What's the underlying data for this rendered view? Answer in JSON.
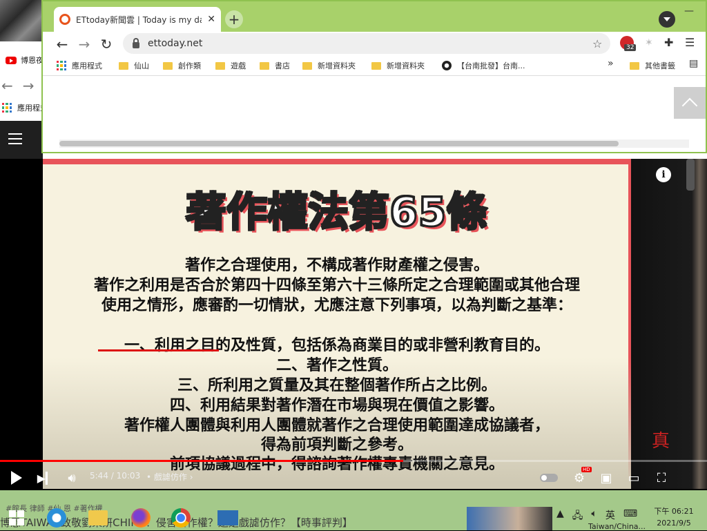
{
  "background_window": {
    "yt_label": "博恩夜",
    "apps_label": "應用程式"
  },
  "chrome": {
    "tab_title": "ETtoday新聞雲 | Today is my day",
    "url": "ettoday.net",
    "extension_count": "32",
    "bookmarks": [
      {
        "label": "應用程式",
        "icon": "apps-grid-icon"
      },
      {
        "label": "仙山",
        "icon": "folder-icon"
      },
      {
        "label": "創作類",
        "icon": "folder-icon"
      },
      {
        "label": "遊戲",
        "icon": "folder-icon"
      },
      {
        "label": "書店",
        "icon": "folder-icon"
      },
      {
        "label": "新增資料夾",
        "icon": "folder-icon"
      },
      {
        "label": "新增資料夾",
        "icon": "folder-icon"
      },
      {
        "label": "【台南批發】台南...",
        "icon": "site-icon"
      }
    ],
    "bookmarks_more": "»",
    "other_bookmarks": "其他書籤"
  },
  "video": {
    "slide_title": "著作權法第65條",
    "slide_lines": [
      "著作之合理使用，不構成著作財產權之侵害。",
      "著作之利用是否合於第四十四條至第六十三條所定之合理範圍或其他合理",
      "使用之情形，應審酌一切情狀，尤應注意下列事項，以為判斷之基準：",
      "",
      "一、利用之目的及性質，包括係為商業目的或非營利教育目的。",
      "二、著作之性質。",
      "三、所利用之質量及其在整個著作所占之比例。",
      "四、利用結果對著作潛在市場與現在價值之影響。",
      "著作權人團體與利用人團體就著作之合理使用範圍達成協議者，",
      "得為前項判斷之參考。",
      "前項協議過程中，得諮詢著作權專責機關之意見。"
    ],
    "seal_text": "真",
    "current_time": "5:44",
    "duration": "10:03",
    "time_display": "5:44 / 10:03",
    "chapter": "• 戲謔仿作 ›",
    "progress": 0.57,
    "hd_label": "HD"
  },
  "taskbar": {
    "under_text_small": "#館長 律師 #仙 恩 #著作權",
    "under_text_title": "博恩TAIWAN致敬劉樂妍CHINA！侵害著作權？還是戲謔仿作？【時事評判】",
    "tray_ime": "英",
    "tray_news": "Taiwan/China...",
    "clock_time": "下午 06:21",
    "clock_date": "2021/9/5"
  },
  "colors": {
    "chrome_frame": "#a8d16a",
    "progress_red": "#ff0000",
    "slide_accent": "#e8545a"
  }
}
